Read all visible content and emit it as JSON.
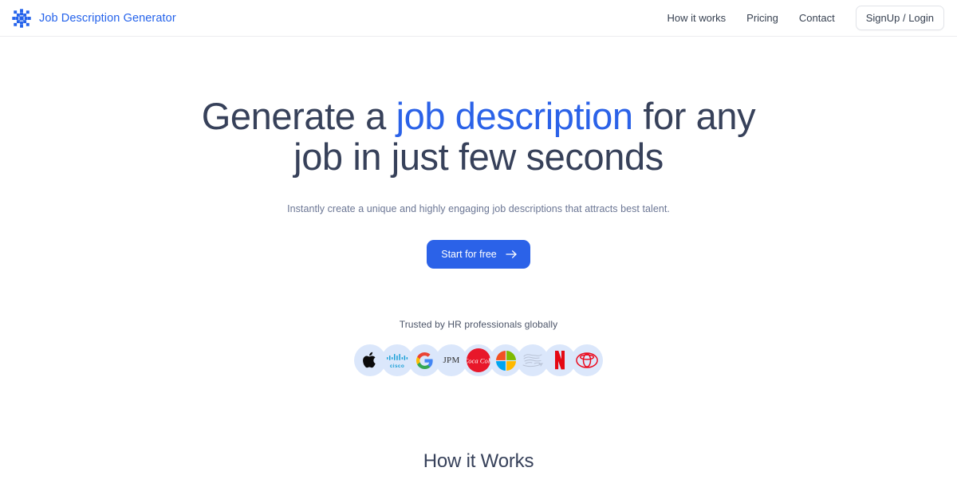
{
  "header": {
    "brand_name": "Job Description Generator",
    "brand_icon": "snowflake-asterisk-logo-icon",
    "nav": [
      {
        "label": "How it works"
      },
      {
        "label": "Pricing"
      },
      {
        "label": "Contact"
      }
    ],
    "auth_button_label": "SignUp / Login"
  },
  "hero": {
    "title_part1": "Generate a ",
    "title_accent": "job description",
    "title_part2": " for any job in just few seconds",
    "subtitle": "Instantly create a unique and highly engaging job descriptions that attracts best talent.",
    "cta_label": "Start for free",
    "cta_icon": "arrow-right-icon"
  },
  "trusted": {
    "label": "Trusted by HR professionals globally",
    "logos": [
      {
        "name": "apple-logo-icon",
        "label": "Apple"
      },
      {
        "name": "cisco-logo-icon",
        "label": "cisco"
      },
      {
        "name": "google-logo-icon",
        "label": "Google"
      },
      {
        "name": "jpmorgan-logo-icon",
        "label": "JPM"
      },
      {
        "name": "coca-cola-logo-icon",
        "label": "Coca-Cola"
      },
      {
        "name": "microsoft-logo-icon",
        "label": "Microsoft"
      },
      {
        "name": "amazon-logo-icon",
        "label": "Amazon"
      },
      {
        "name": "netflix-logo-icon",
        "label": "Netflix"
      },
      {
        "name": "toyota-logo-icon",
        "label": "Toyota"
      }
    ]
  },
  "how_section": {
    "title": "How it Works"
  },
  "colors": {
    "accent_blue": "#2b62e8",
    "brand_blue": "#2563eb",
    "text_dark": "#37415a",
    "text_muted": "#6b7694",
    "chip_background": "#dbe7fb",
    "border_light": "#ededf0"
  }
}
